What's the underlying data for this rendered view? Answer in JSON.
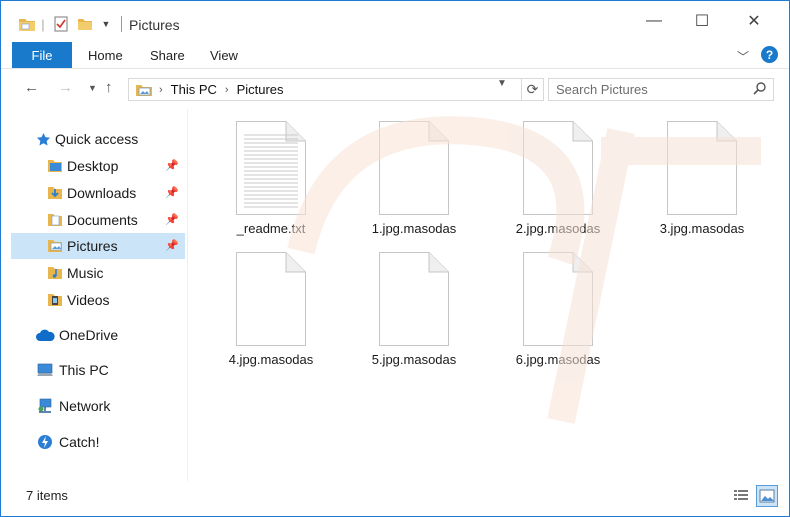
{
  "window": {
    "title": "Pictures",
    "controls": {
      "minimize": "—",
      "maximize": "☐",
      "close": "✕"
    }
  },
  "ribbon": {
    "file": "File",
    "tabs": [
      "Home",
      "Share",
      "View"
    ],
    "help": "?"
  },
  "address": {
    "crumbs": [
      "This PC",
      "Pictures"
    ],
    "search_placeholder": "Search Pictures"
  },
  "nav": {
    "quick_access": "Quick access",
    "quick_items": [
      {
        "label": "Desktop",
        "pinned": true
      },
      {
        "label": "Downloads",
        "pinned": true
      },
      {
        "label": "Documents",
        "pinned": true
      },
      {
        "label": "Pictures",
        "pinned": true
      },
      {
        "label": "Music",
        "pinned": false
      },
      {
        "label": "Videos",
        "pinned": false
      }
    ],
    "onedrive": "OneDrive",
    "thispc": "This PC",
    "network": "Network",
    "catch": "Catch!"
  },
  "files": [
    {
      "name": "_readme.txt",
      "kind": "text"
    },
    {
      "name": "1.jpg.masodas",
      "kind": "blank"
    },
    {
      "name": "2.jpg.masodas",
      "kind": "blank"
    },
    {
      "name": "3.jpg.masodas",
      "kind": "blank"
    },
    {
      "name": "4.jpg.masodas",
      "kind": "blank"
    },
    {
      "name": "5.jpg.masodas",
      "kind": "blank"
    },
    {
      "name": "6.jpg.masodas",
      "kind": "blank"
    }
  ],
  "status": {
    "count": "7 items"
  },
  "colors": {
    "accent": "#1979ca",
    "selected": "#cce4f7",
    "folder": "#e8b64c"
  }
}
